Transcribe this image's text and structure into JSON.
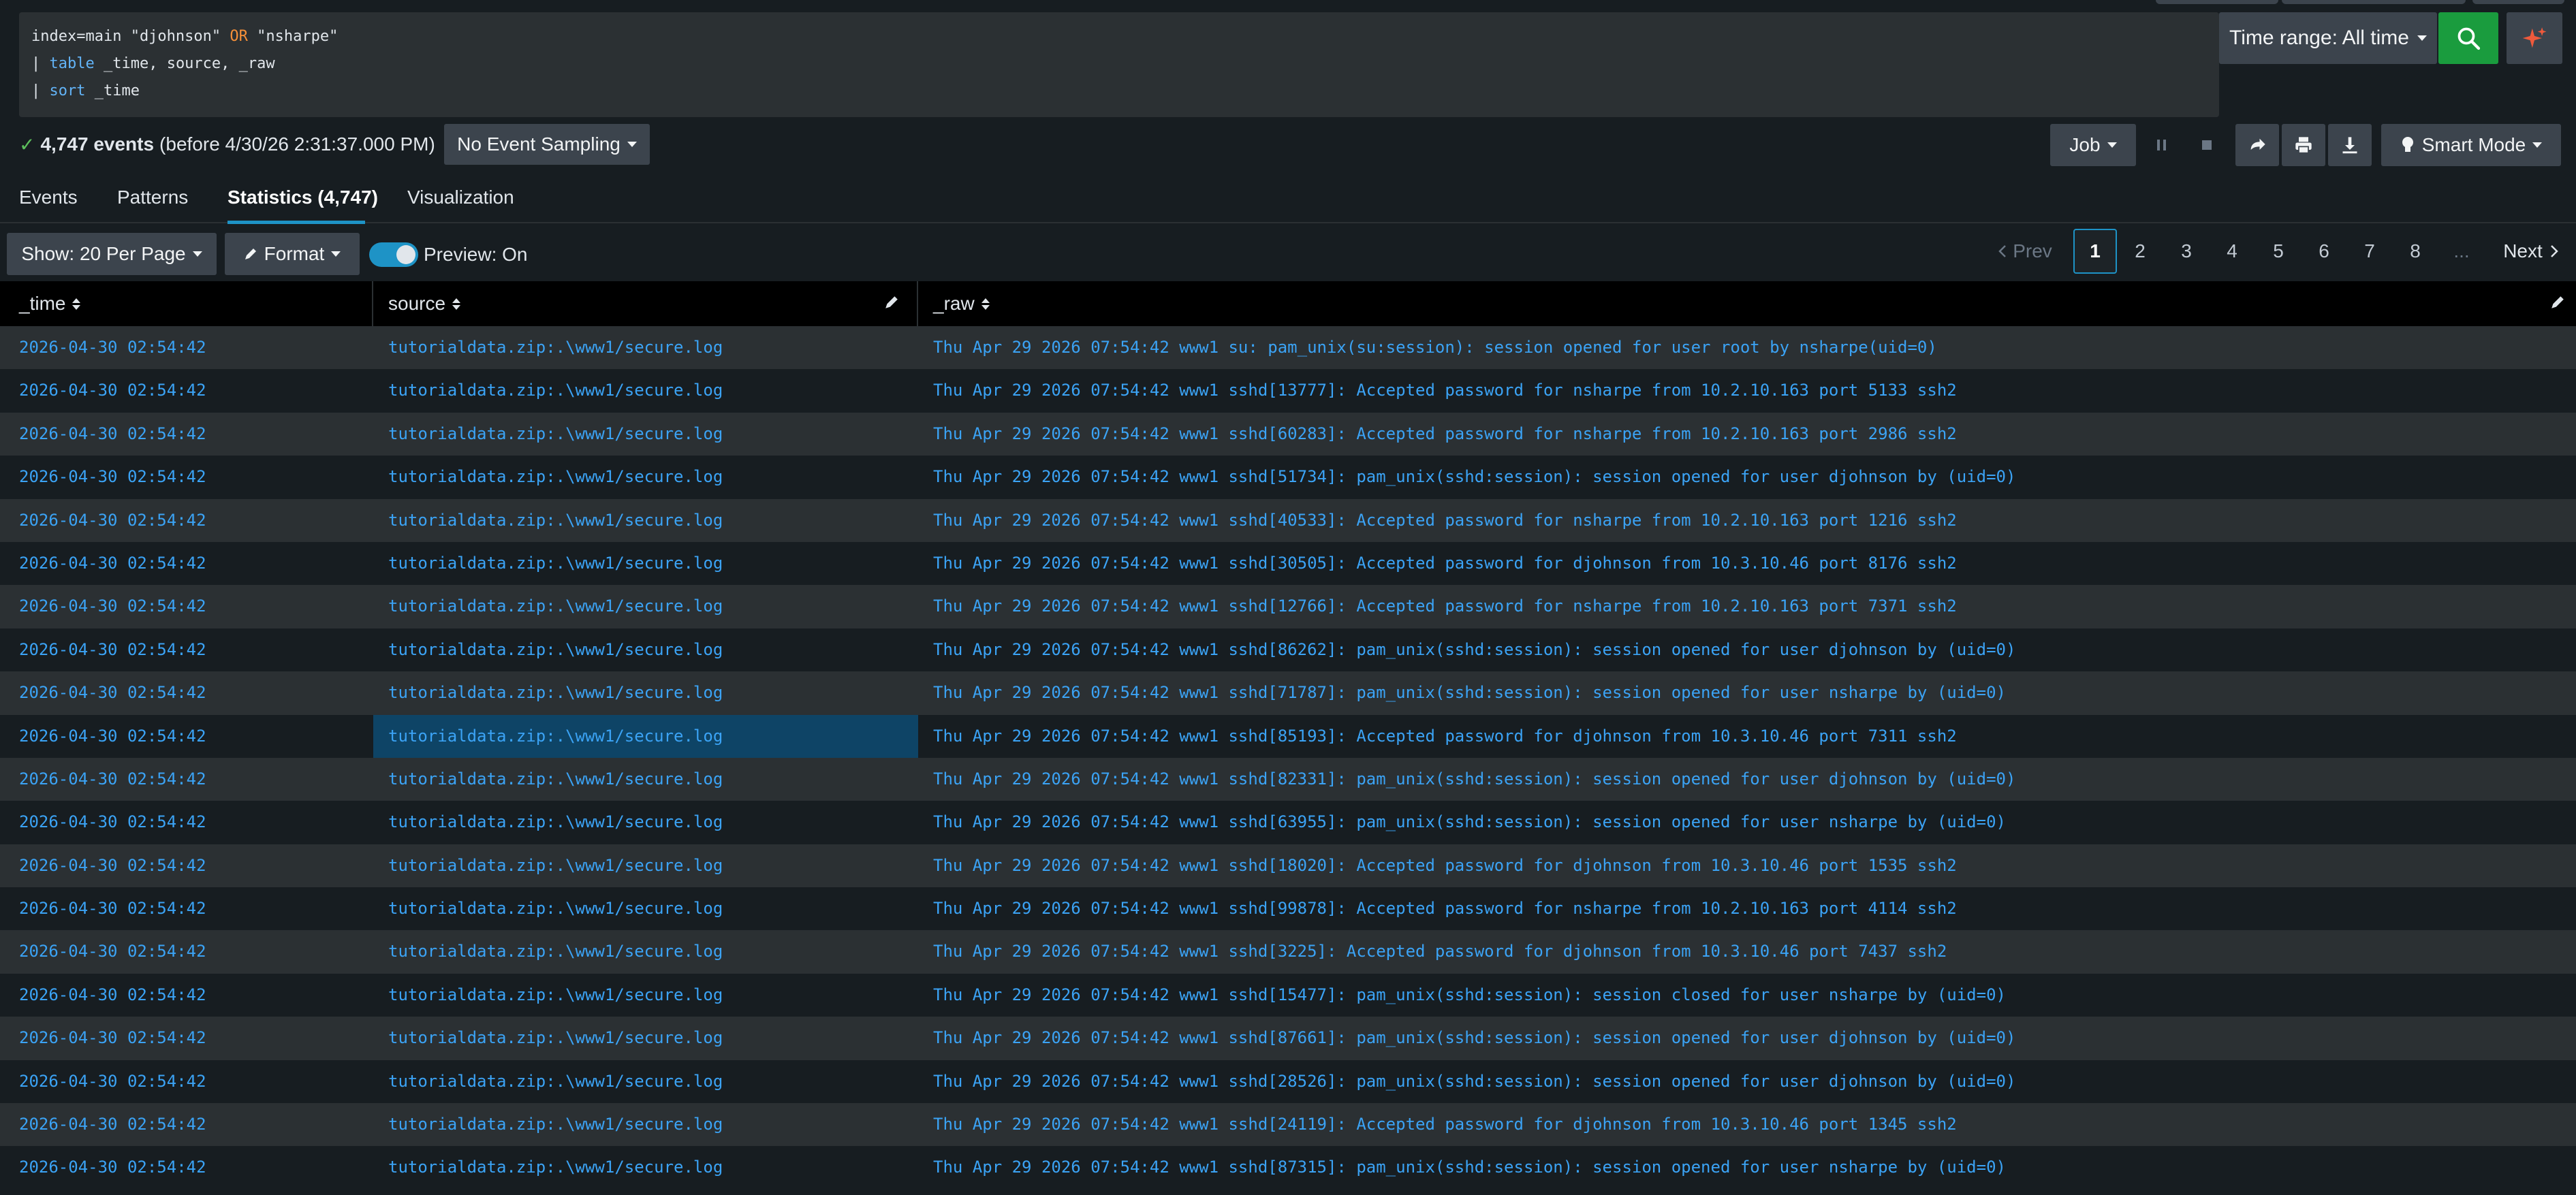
{
  "search": {
    "query_lines": [
      {
        "pre": "index=main \"djohnson\" ",
        "or": "OR",
        "post": " \"nsharpe\""
      },
      {
        "pipe": "| ",
        "cmd": "table",
        "rest": " _time, source, _raw"
      },
      {
        "pipe": "| ",
        "cmd": "sort",
        "rest": " _time"
      }
    ],
    "time_range_label": "Time range: All time",
    "search_button_icon": "search-icon",
    "ai_button_icon": "sparkle-icon"
  },
  "status": {
    "event_count": "4,747 events",
    "event_suffix": "(before 4/30/26 2:31:37.000 PM)",
    "sampling_label": "No Event Sampling",
    "job_label": "Job",
    "mode_label": "Smart Mode"
  },
  "tabs": [
    {
      "label": "Events"
    },
    {
      "label": "Patterns"
    },
    {
      "label": "Statistics (4,747)",
      "active": true
    },
    {
      "label": "Visualization"
    }
  ],
  "toolbar": {
    "per_page_label": "Show: 20 Per Page",
    "format_label": "Format",
    "preview_label": "Preview: On"
  },
  "pagination": {
    "prev_label": "Prev",
    "pages": [
      "1",
      "2",
      "3",
      "4",
      "5",
      "6",
      "7",
      "8"
    ],
    "current_page": "1",
    "ellipsis": "...",
    "next_label": "Next"
  },
  "table": {
    "columns": [
      "_time",
      "source",
      "_raw"
    ],
    "rows": [
      [
        "2026-04-30 02:54:42",
        "tutorialdata.zip:.\\www1/secure.log",
        "Thu Apr 29 2026 07:54:42 www1 su: pam_unix(su:session): session opened for user root by nsharpe(uid=0)"
      ],
      [
        "2026-04-30 02:54:42",
        "tutorialdata.zip:.\\www1/secure.log",
        "Thu Apr 29 2026 07:54:42 www1 sshd[13777]: Accepted password for nsharpe from 10.2.10.163 port 5133 ssh2"
      ],
      [
        "2026-04-30 02:54:42",
        "tutorialdata.zip:.\\www1/secure.log",
        "Thu Apr 29 2026 07:54:42 www1 sshd[60283]: Accepted password for nsharpe from 10.2.10.163 port 2986 ssh2"
      ],
      [
        "2026-04-30 02:54:42",
        "tutorialdata.zip:.\\www1/secure.log",
        "Thu Apr 29 2026 07:54:42 www1 sshd[51734]: pam_unix(sshd:session): session opened for user djohnson by (uid=0)"
      ],
      [
        "2026-04-30 02:54:42",
        "tutorialdata.zip:.\\www1/secure.log",
        "Thu Apr 29 2026 07:54:42 www1 sshd[40533]: Accepted password for nsharpe from 10.2.10.163 port 1216 ssh2"
      ],
      [
        "2026-04-30 02:54:42",
        "tutorialdata.zip:.\\www1/secure.log",
        "Thu Apr 29 2026 07:54:42 www1 sshd[30505]: Accepted password for djohnson from 10.3.10.46 port 8176 ssh2"
      ],
      [
        "2026-04-30 02:54:42",
        "tutorialdata.zip:.\\www1/secure.log",
        "Thu Apr 29 2026 07:54:42 www1 sshd[12766]: Accepted password for nsharpe from 10.2.10.163 port 7371 ssh2"
      ],
      [
        "2026-04-30 02:54:42",
        "tutorialdata.zip:.\\www1/secure.log",
        "Thu Apr 29 2026 07:54:42 www1 sshd[86262]: pam_unix(sshd:session): session opened for user djohnson by (uid=0)"
      ],
      [
        "2026-04-30 02:54:42",
        "tutorialdata.zip:.\\www1/secure.log",
        "Thu Apr 29 2026 07:54:42 www1 sshd[71787]: pam_unix(sshd:session): session opened for user nsharpe by (uid=0)"
      ],
      [
        "2026-04-30 02:54:42",
        "tutorialdata.zip:.\\www1/secure.log",
        "Thu Apr 29 2026 07:54:42 www1 sshd[85193]: Accepted password for djohnson from 10.3.10.46 port 7311 ssh2"
      ],
      [
        "2026-04-30 02:54:42",
        "tutorialdata.zip:.\\www1/secure.log",
        "Thu Apr 29 2026 07:54:42 www1 sshd[82331]: pam_unix(sshd:session): session opened for user djohnson by (uid=0)"
      ],
      [
        "2026-04-30 02:54:42",
        "tutorialdata.zip:.\\www1/secure.log",
        "Thu Apr 29 2026 07:54:42 www1 sshd[63955]: pam_unix(sshd:session): session opened for user nsharpe by (uid=0)"
      ],
      [
        "2026-04-30 02:54:42",
        "tutorialdata.zip:.\\www1/secure.log",
        "Thu Apr 29 2026 07:54:42 www1 sshd[18020]: Accepted password for djohnson from 10.3.10.46 port 1535 ssh2"
      ],
      [
        "2026-04-30 02:54:42",
        "tutorialdata.zip:.\\www1/secure.log",
        "Thu Apr 29 2026 07:54:42 www1 sshd[99878]: Accepted password for nsharpe from 10.2.10.163 port 4114 ssh2"
      ],
      [
        "2026-04-30 02:54:42",
        "tutorialdata.zip:.\\www1/secure.log",
        "Thu Apr 29 2026 07:54:42 www1 sshd[3225]: Accepted password for djohnson from 10.3.10.46 port 7437 ssh2"
      ],
      [
        "2026-04-30 02:54:42",
        "tutorialdata.zip:.\\www1/secure.log",
        "Thu Apr 29 2026 07:54:42 www1 sshd[15477]: pam_unix(sshd:session): session closed for user nsharpe by (uid=0)"
      ],
      [
        "2026-04-30 02:54:42",
        "tutorialdata.zip:.\\www1/secure.log",
        "Thu Apr 29 2026 07:54:42 www1 sshd[87661]: pam_unix(sshd:session): session opened for user djohnson by (uid=0)"
      ],
      [
        "2026-04-30 02:54:42",
        "tutorialdata.zip:.\\www1/secure.log",
        "Thu Apr 29 2026 07:54:42 www1 sshd[28526]: pam_unix(sshd:session): session opened for user djohnson by (uid=0)"
      ],
      [
        "2026-04-30 02:54:42",
        "tutorialdata.zip:.\\www1/secure.log",
        "Thu Apr 29 2026 07:54:42 www1 sshd[24119]: Accepted password for djohnson from 10.3.10.46 port 1345 ssh2"
      ],
      [
        "2026-04-30 02:54:42",
        "tutorialdata.zip:.\\www1/secure.log",
        "Thu Apr 29 2026 07:54:42 www1 sshd[87315]: pam_unix(sshd:session): session opened for user nsharpe by (uid=0)"
      ]
    ],
    "selected_row": 9
  },
  "colors": {
    "background": "#171d21",
    "row_alt": "#2b3033",
    "link": "#3ba3f5",
    "accent": "#1e93c6",
    "search_green": "#1a9c3e",
    "keyword_or": "#f58f39"
  }
}
